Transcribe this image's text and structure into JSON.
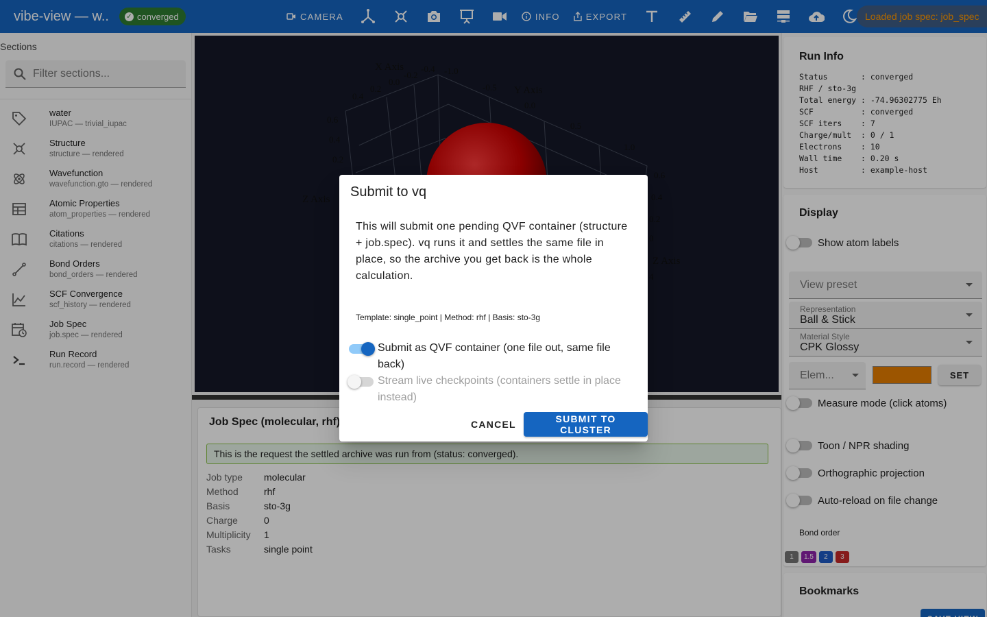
{
  "app": {
    "title": "vibe-view — w...",
    "status": "converged"
  },
  "toolbar": {
    "camera_label": "CAMERA",
    "info_label": "INFO",
    "export_label": "EXPORT",
    "loaded_message": "Loaded job spec: job_spec"
  },
  "sidebar": {
    "header": "Sections",
    "filter_placeholder": "Filter sections...",
    "items": [
      {
        "title": "water",
        "subtitle": "IUPAC — trivial_iupac",
        "icon": "tag-icon"
      },
      {
        "title": "Structure",
        "subtitle": "structure — rendered",
        "icon": "molecule-icon"
      },
      {
        "title": "Wavefunction",
        "subtitle": "wavefunction.gto — rendered",
        "icon": "atom-icon"
      },
      {
        "title": "Atomic Properties",
        "subtitle": "atom_properties — rendered",
        "icon": "table-icon"
      },
      {
        "title": "Citations",
        "subtitle": "citations — rendered",
        "icon": "book-icon"
      },
      {
        "title": "Bond Orders",
        "subtitle": "bond_orders — rendered",
        "icon": "bond-icon"
      },
      {
        "title": "SCF Convergence",
        "subtitle": "scf_history — rendered",
        "icon": "chart-line-icon"
      },
      {
        "title": "Job Spec",
        "subtitle": "job.spec — rendered",
        "icon": "calendar-clock-icon"
      },
      {
        "title": "Run Record",
        "subtitle": "run.record — rendered",
        "icon": "terminal-icon"
      }
    ]
  },
  "viewer": {
    "axis_labels": {
      "x": "X Axis",
      "y": "Y Axis",
      "z_left": "Z Axis",
      "z_right": "Z Axis"
    },
    "ticks": {
      "x": [
        "0.4",
        "0.2",
        "0.0",
        "-0.2",
        "-0.4"
      ],
      "y_top": [
        "-1.0",
        "-0.5",
        "0.0",
        "0.5",
        "1.0"
      ],
      "z_left": [
        "0.6",
        "0.4",
        "0.2"
      ],
      "z_right": [
        "0.6",
        "0.4",
        "0.2",
        "0",
        "4"
      ]
    }
  },
  "job_spec": {
    "title": "Job Spec (molecular, rhf)",
    "alert": "This is the request the settled archive was run from (status: converged).",
    "rows": [
      {
        "k": "Job type",
        "v": "molecular"
      },
      {
        "k": "Method",
        "v": "rhf"
      },
      {
        "k": "Basis",
        "v": "sto-3g"
      },
      {
        "k": "Charge",
        "v": "0"
      },
      {
        "k": "Multiplicity",
        "v": "1"
      },
      {
        "k": "Tasks",
        "v": "single point"
      }
    ]
  },
  "run_info": {
    "title": "Run Info",
    "lines": [
      "Status       : converged",
      "RHF / sto-3g",
      "Total energy : -74.96302775 Eh",
      "SCF          : converged",
      "SCF iters    : 7",
      "Charge/mult  : 0 / 1",
      "Electrons    : 10",
      "Wall time    : 0.20 s",
      "Host         : example-host"
    ]
  },
  "display": {
    "title": "Display",
    "show_atom_labels": "Show atom labels",
    "view_preset_placeholder": "View preset",
    "representation_label": "Representation",
    "representation_value": "Ball & Stick",
    "material_label": "Material Style",
    "material_value": "CPK Glossy",
    "element_placeholder": "Elem...",
    "element_color": "#e67e00",
    "set_label": "SET",
    "measure_mode": "Measure mode (click atoms)",
    "toon_shading": "Toon / NPR shading",
    "ortho": "Orthographic projection",
    "auto_reload": "Auto-reload on file change",
    "bond_order_label": "Bond order",
    "bond_orders": [
      {
        "label": "1",
        "color": "#757575"
      },
      {
        "label": "1.5",
        "color": "#8e24aa"
      },
      {
        "label": "2",
        "color": "#1e5bc6"
      },
      {
        "label": "3",
        "color": "#c62828"
      }
    ]
  },
  "bookmarks": {
    "title": "Bookmarks",
    "save_label": "SAVE VIEW"
  },
  "dialog": {
    "title": "Submit to vq",
    "body": "This will submit one pending QVF container (structure + job.spec). vq runs it and settles the same file in place, so the archive you get back is the whole calculation.",
    "meta": "Template: single_point | Method: rhf | Basis: sto-3g",
    "option1": "Submit as QVF container (one file out, same file back)",
    "option1_on": true,
    "option2": "Stream live checkpoints (containers settle in place instead)",
    "option2_on": false,
    "cancel_label": "CANCEL",
    "submit_label": "SUBMIT TO CLUSTER"
  }
}
